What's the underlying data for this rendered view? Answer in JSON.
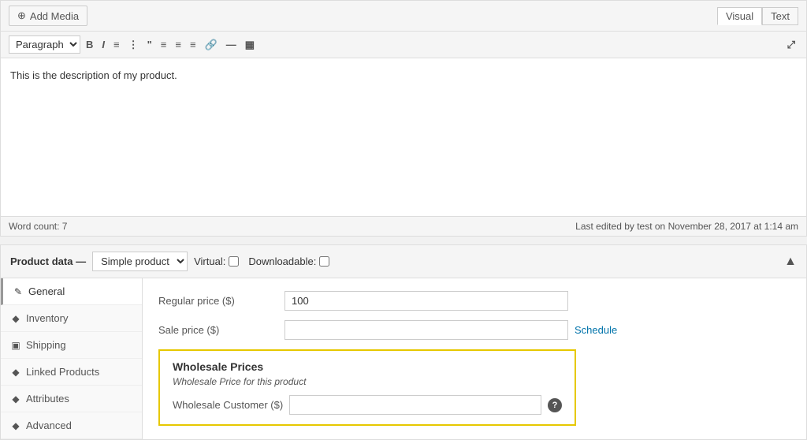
{
  "editor": {
    "add_media_label": "Add Media",
    "visual_tab": "Visual",
    "text_tab": "Text",
    "paragraph_option": "Paragraph",
    "content": "This is the description of my product.",
    "word_count_label": "Word count: 7",
    "last_edited": "Last edited by test on November 28, 2017 at 1:14 am"
  },
  "product_data": {
    "title": "Product data",
    "separator": "—",
    "type_label": "Simple product",
    "virtual_label": "Virtual:",
    "downloadable_label": "Downloadable:",
    "tabs": [
      {
        "id": "general",
        "label": "General",
        "icon": "✎",
        "active": true
      },
      {
        "id": "inventory",
        "label": "Inventory",
        "icon": "◆"
      },
      {
        "id": "shipping",
        "label": "Shipping",
        "icon": "▣"
      },
      {
        "id": "linked-products",
        "label": "Linked Products",
        "icon": "◆"
      },
      {
        "id": "attributes",
        "label": "Attributes",
        "icon": "◆"
      },
      {
        "id": "advanced",
        "label": "Advanced",
        "icon": "◆"
      }
    ],
    "general": {
      "regular_price_label": "Regular price ($)",
      "regular_price_value": "100",
      "sale_price_label": "Sale price ($)",
      "sale_price_value": "",
      "schedule_link": "Schedule",
      "wholesale": {
        "title": "Wholesale Prices",
        "subtitle": "Wholesale Price for this product",
        "customer_label": "Wholesale Customer ($)",
        "customer_value": ""
      }
    }
  }
}
